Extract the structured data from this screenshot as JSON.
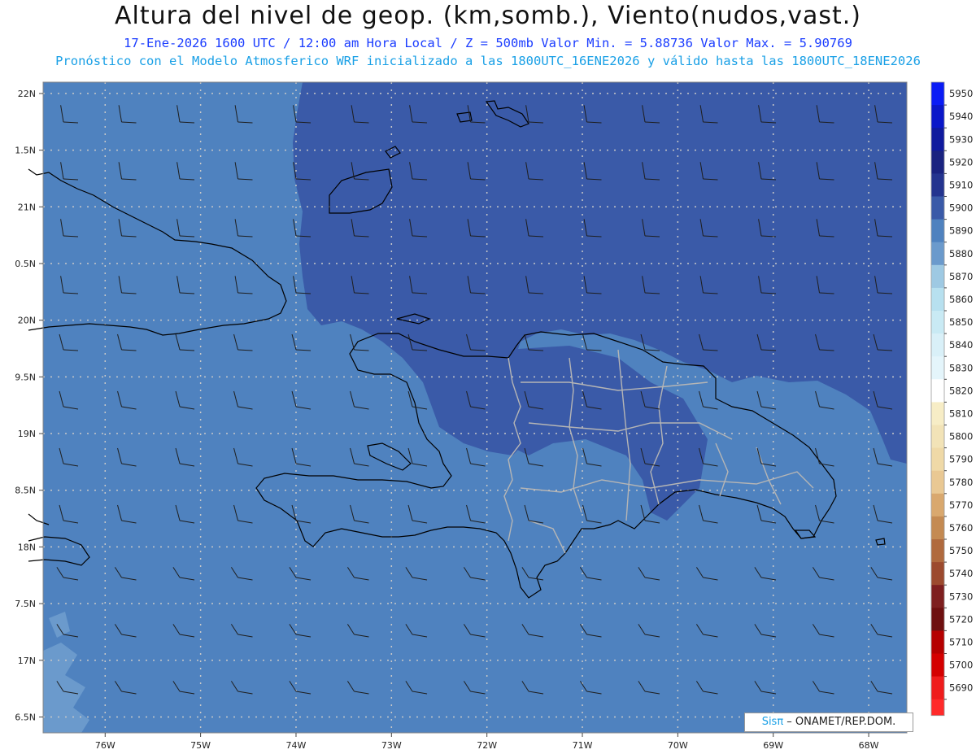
{
  "header": {
    "title": "Altura del nivel de geop. (km,somb.), Viento(nudos,vast.)",
    "subtitle_line1": "17-Ene-2026  1600 UTC / 12:00 am Hora Local / Z = 500mb   Valor Min. = 5.88736  Valor Max. = 5.90769",
    "subtitle_line2": "Pronóstico con el Modelo Atmosferico WRF inicializado a las 1800UTC_16ENE2026 y válido hasta las  1800UTC_18ENE2026"
  },
  "map": {
    "lon_range": [
      -76.65,
      -67.6
    ],
    "lat_range": [
      16.36,
      22.1
    ],
    "lat_ticks": [
      "22N",
      "1.5N",
      "21N",
      "0.5N",
      "20N",
      "9.5N",
      "19N",
      "8.5N",
      "18N",
      "7.5N",
      "17N",
      "6.5N"
    ],
    "lat_tick_values": [
      22,
      21.5,
      21,
      20.5,
      20,
      19.5,
      19,
      18.5,
      18,
      17.5,
      17,
      16.5
    ],
    "lon_ticks": [
      "76W",
      "75W",
      "74W",
      "73W",
      "72W",
      "71W",
      "70W",
      "69W",
      "68W"
    ],
    "lon_tick_values": [
      -76,
      -75,
      -74,
      -73,
      -72,
      -71,
      -70,
      -69,
      -68
    ],
    "colors": {
      "field_low": "#4f82bf",
      "field_high": "#3a5aa8",
      "field_min": "#6b9acc",
      "grid": "#c8c8c8",
      "coast": "#000000",
      "borders": "#b5b5b5",
      "barbs": "#1e1e1e"
    }
  },
  "colorbar": {
    "levels": [
      "5950",
      "5940",
      "5930",
      "5920",
      "5910",
      "5900",
      "5890",
      "5880",
      "5870",
      "5860",
      "5850",
      "5840",
      "5830",
      "5820",
      "5810",
      "5800",
      "5790",
      "5780",
      "5770",
      "5760",
      "5750",
      "5740",
      "5730",
      "5720",
      "5710",
      "5700",
      "5690"
    ],
    "colors": [
      "#0a1cf5",
      "#0a17c9",
      "#0f1a9e",
      "#1a2380",
      "#24348f",
      "#3a5aa8",
      "#4f82bf",
      "#6b9acc",
      "#9ec9e3",
      "#b7e0ef",
      "#c9eaf4",
      "#d9f0f8",
      "#e4f5fb",
      "#ffffff",
      "#f7edc6",
      "#f2e3b7",
      "#efd9a7",
      "#e9c893",
      "#d9a86e",
      "#c48a52",
      "#b06a3e",
      "#9c4a2e",
      "#7e1f1f",
      "#6e0f0f",
      "#b50000",
      "#d40000",
      "#ef1c1c"
    ],
    "bottom_color": "#ff2a2a"
  },
  "credit": {
    "brand_a": "Sis",
    "brand_b": "π",
    "rest": " ONAMET/REP.DOM."
  }
}
